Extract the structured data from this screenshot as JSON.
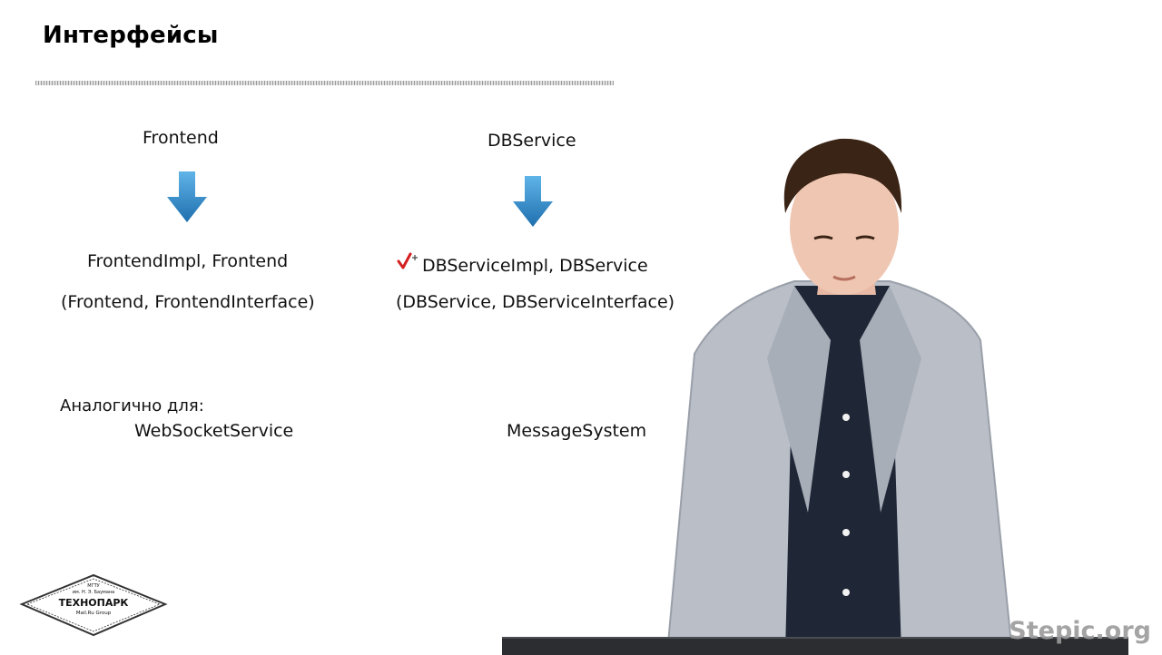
{
  "slide": {
    "title": "Интерфейсы",
    "left_column": {
      "name": "Frontend",
      "impl": "FrontendImpl, Frontend",
      "alt": "(Frontend, FrontendInterface)"
    },
    "right_column": {
      "name": "DBService",
      "impl": "DBServiceImpl, DBService",
      "alt": "(DBService, DBServiceInterface)"
    },
    "similar_label": "Аналогично для:",
    "similar_items": [
      "WebSocketService",
      "MessageSystem"
    ]
  },
  "logo": {
    "line1": "МГТУ",
    "line2": "им. Н. Э. Баумана",
    "brand": "ТЕХНОПАРК",
    "sub": "Mail.Ru Group"
  },
  "watermark": "Stepic.org",
  "colors": {
    "arrow_top": "#4aa3dc",
    "arrow_bottom": "#1f6fae",
    "pen_mark": "#d42020",
    "watermark": "#9b9b9b"
  },
  "icons": {
    "arrow": "down-arrow-icon",
    "pen": "checkmark-cursor-icon"
  }
}
